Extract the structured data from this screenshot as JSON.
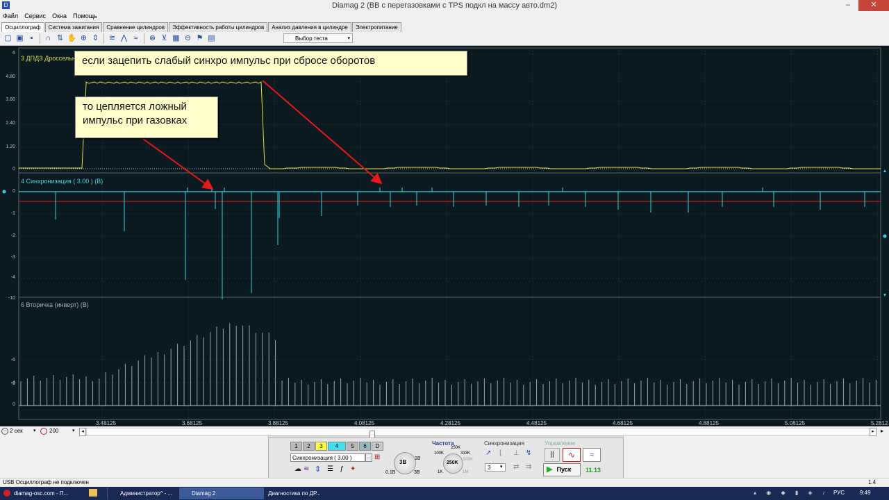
{
  "window": {
    "title": "Diamag 2 (ВВ с перегазовками с TPS подкл на массу авто.dm2)",
    "minimize": "–",
    "maximize": "❐",
    "close": "✕"
  },
  "menu": [
    "Файл",
    "Сервис",
    "Окна",
    "Помощь"
  ],
  "tabs": [
    "Осциллограф",
    "Система зажигания",
    "Сравнение цилиндров",
    "Эффективность работы цилиндров",
    "Анализ давления в цилиндре",
    "Электропитание"
  ],
  "active_tab": "Осциллограф",
  "toolbar": {
    "icons": [
      "new-file-icon",
      "open-folder-icon",
      "save-icon",
      "loop-icon",
      "cursor-icon",
      "hand-icon",
      "zoom-icon",
      "align-icon",
      "channels-icon",
      "scale-icon",
      "sync-icon",
      "measure-icon",
      "filter-icon",
      "table-icon",
      "compare-icon",
      "marker-icon",
      "notes-icon"
    ],
    "test_select": "Выбор теста"
  },
  "panels": [
    {
      "title": "3 ДПДЗ Дроссельн",
      "title_color": "#d8d85a",
      "y_ticks": [
        "6",
        "4.80",
        "3.60",
        "2.40",
        "1.20",
        "0"
      ]
    },
    {
      "title": "4 Синхронизация ( 3.00 ) (В)",
      "title_color": "#3fd6e0",
      "y_ticks": [
        "0",
        "-1",
        "-2",
        "-3",
        "-4",
        "-10"
      ]
    },
    {
      "title": "6 Вторичка (инверт) (В)",
      "title_color": "#9fb2b8",
      "y_ticks": [
        "-6",
        "-4",
        "-2",
        "0"
      ]
    }
  ],
  "x_ticks": [
    "3.48125",
    "3.68125",
    "3.88125",
    "4.08125",
    "4.28125",
    "4.48125",
    "4.68125",
    "4.88125",
    "5.08125",
    "5.2812"
  ],
  "annotations": [
    "если зацепить слабый синхро импульс при сбросе оборотов",
    "то цепляется ложный импульс при газовках"
  ],
  "scroll": {
    "time_span": "2 сек",
    "points": "200"
  },
  "control": {
    "channels": [
      "1",
      "2",
      "3",
      "4",
      "5",
      "6",
      "D"
    ],
    "channel_input": "Синхронизация ( 3.00 )",
    "channel_input_btn": "...",
    "knob_volts": "3В",
    "knob_min": "0.1В",
    "knob_max": "3В",
    "knob_1v": "1В",
    "freq_label": "Частота",
    "freq_marks": [
      "250K",
      "100K",
      "333K",
      "500K",
      "1K",
      "1M"
    ],
    "freq_value": "250K",
    "sync_label": "Синхронизация",
    "sync_value": "3",
    "control_label": "Управление",
    "start_label": "Пуск",
    "elapsed": "11.13"
  },
  "status": {
    "left": "USB Осциллограф не подключен",
    "right": "1.4"
  },
  "taskbar": {
    "items": [
      "diamag-osc.com - П...",
      "Администратор^ - ...",
      "Diamag 2",
      "Диагностика по ДР..."
    ],
    "lang": "РУС",
    "time": "9:49"
  },
  "colors": {
    "tps": "#e2e04a",
    "sync": "#35d4e0",
    "secondary": "#aebfc8",
    "trigger_line": "#e02020",
    "grid": "#2b3a40",
    "background": "#0b1a20"
  }
}
